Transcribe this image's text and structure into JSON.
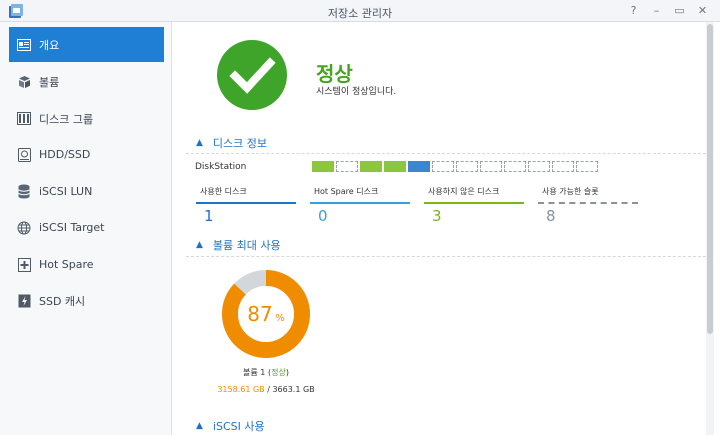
{
  "window": {
    "title": "저장소 관리자",
    "controls": [
      "?",
      "–",
      "▭",
      "✕"
    ]
  },
  "sidebar": {
    "items": [
      {
        "label": "개요",
        "icon": "overview-icon",
        "active": true
      },
      {
        "label": "볼륨",
        "icon": "volume-icon",
        "active": false
      },
      {
        "label": "디스크 그룹",
        "icon": "disk-group-icon",
        "active": false
      },
      {
        "label": "HDD/SSD",
        "icon": "hdd-icon",
        "active": false
      },
      {
        "label": "iSCSI LUN",
        "icon": "iscsi-lun-icon",
        "active": false
      },
      {
        "label": "iSCSI Target",
        "icon": "globe-icon",
        "active": false
      },
      {
        "label": "Hot Spare",
        "icon": "hot-spare-icon",
        "active": false
      },
      {
        "label": "SSD 캐시",
        "icon": "ssd-cache-icon",
        "active": false
      }
    ]
  },
  "status": {
    "title": "정상",
    "description": "시스템이 정상입니다.",
    "color": "#45a51f",
    "icon": "check-icon"
  },
  "disk_info": {
    "header": "디스크 정보",
    "device": "DiskStation",
    "slots": [
      "green",
      "empty",
      "green",
      "green",
      "blue",
      "empty",
      "empty",
      "empty",
      "empty",
      "empty",
      "empty",
      "empty"
    ],
    "stats": [
      {
        "label": "사용한 디스크",
        "value": "1",
        "color": "#1f72c4",
        "line": "solid"
      },
      {
        "label": "Hot Spare 디스크",
        "value": "0",
        "color": "#3a9fd8",
        "line": "solid"
      },
      {
        "label": "사용하지 않은 디스크",
        "value": "3",
        "color": "#7ab51d",
        "line": "solid"
      },
      {
        "label": "사용 가능한 슬롯",
        "value": "8",
        "color": "#8a939c",
        "line": "dashed"
      }
    ]
  },
  "volume_usage": {
    "header": "볼륨 최대 사용",
    "percent_value": "87",
    "percent_sign": "%",
    "fraction": 0.87,
    "volume_name": "볼륨 1",
    "volume_status": "정상",
    "used": "3158.61 GB",
    "separator": "/",
    "total": "3663.1 GB",
    "accent_color": "#f08c00"
  },
  "iscsi_usage": {
    "header": "iSCSI 사용"
  }
}
